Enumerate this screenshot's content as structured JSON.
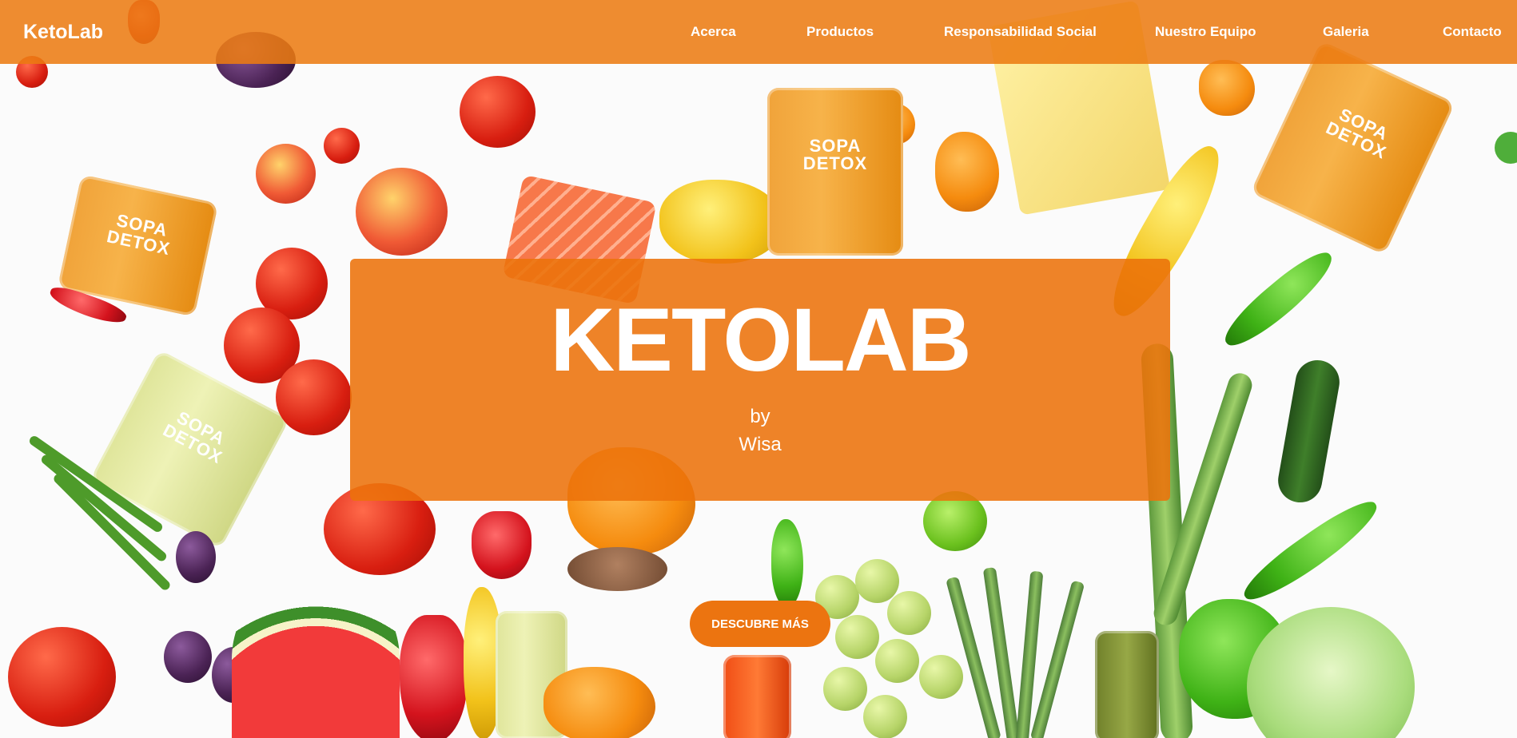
{
  "nav": {
    "brand": "KetoLab",
    "links": [
      {
        "label": "Acerca"
      },
      {
        "label": "Productos"
      },
      {
        "label": "Responsabilidad Social"
      },
      {
        "label": "Nuestro Equipo"
      },
      {
        "label": "Galeria"
      },
      {
        "label": "Contacto"
      }
    ]
  },
  "hero": {
    "title": "KETOLAB",
    "by": "by",
    "brand": "Wisa",
    "cta_label": "DESCUBRE MÁS",
    "jar_label": "SOPA\nDETOX"
  },
  "colors": {
    "accent": "#ec7410",
    "text_on_accent": "#ffffff"
  }
}
